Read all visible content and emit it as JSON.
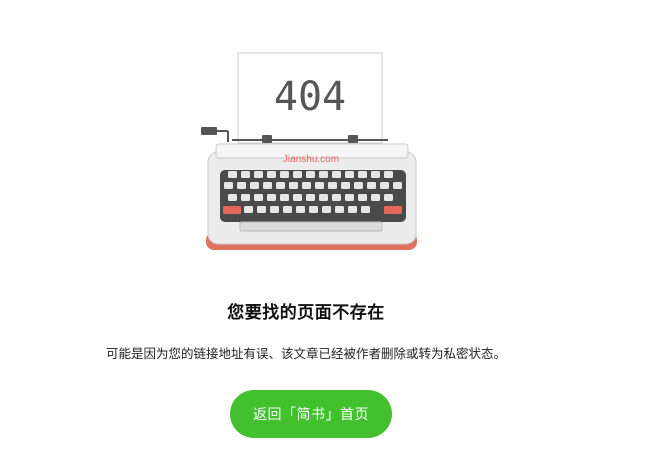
{
  "illustration": {
    "code_text": "404",
    "brand_text": "Jianshu.com"
  },
  "error": {
    "title": "您要找的页面不存在",
    "description": "可能是因为您的链接地址有误、该文章已经被作者删除或转为私密状态。"
  },
  "actions": {
    "home_label": "返回「简书」首页"
  },
  "colors": {
    "accent": "#42c02e",
    "typewriter_red": "#e0735f",
    "key_red": "#e5665a"
  }
}
